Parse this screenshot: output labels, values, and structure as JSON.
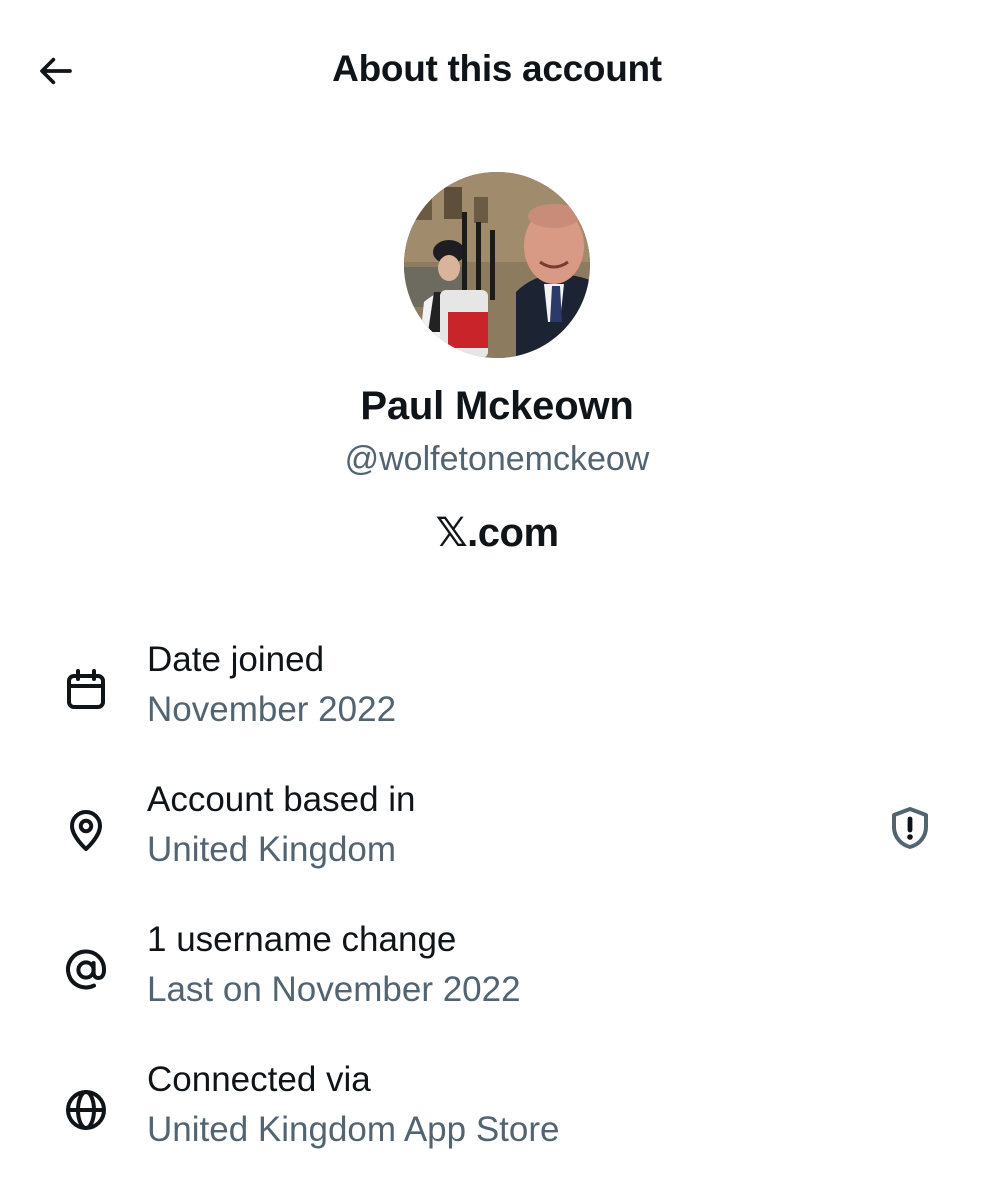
{
  "header": {
    "title": "About this account",
    "back_icon": "arrow-left-icon"
  },
  "profile": {
    "name": "Paul Mckeown",
    "handle": "@wolfetonemckeow",
    "site": "𝕏.com"
  },
  "details": [
    {
      "icon": "calendar-icon",
      "label": "Date joined",
      "value": "November 2022"
    },
    {
      "icon": "location-pin-icon",
      "label": "Account based in",
      "value": "United Kingdom",
      "trailing_icon": "shield-alert-icon"
    },
    {
      "icon": "at-sign-icon",
      "label": "1 username change",
      "value": "Last on November 2022"
    },
    {
      "icon": "globe-icon",
      "label": "Connected via",
      "value": "United Kingdom App Store"
    }
  ],
  "colors": {
    "primary_text": "#0f1419",
    "secondary_text": "#536471",
    "background": "#ffffff"
  }
}
